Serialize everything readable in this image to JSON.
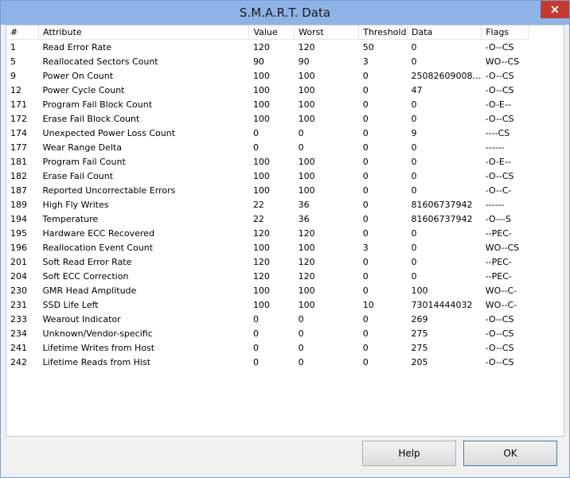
{
  "window": {
    "title": "S.M.A.R.T. Data",
    "close_glyph": "✕"
  },
  "table": {
    "columns": [
      "#",
      "Attribute",
      "Value",
      "Worst",
      "Threshold",
      "Data",
      "Flags"
    ],
    "rows": [
      [
        "1",
        "Read Error Rate",
        "120",
        "120",
        "50",
        "0",
        "-O--CS"
      ],
      [
        "5",
        "Reallocated Sectors Count",
        "90",
        "90",
        "3",
        "0",
        "WO--CS"
      ],
      [
        "9",
        "Power On Count",
        "100",
        "100",
        "0",
        "250826090086...",
        "-O--CS"
      ],
      [
        "12",
        "Power Cycle Count",
        "100",
        "100",
        "0",
        "47",
        "-O--CS"
      ],
      [
        "171",
        "Program Fail Block Count",
        "100",
        "100",
        "0",
        "0",
        "-O-E--"
      ],
      [
        "172",
        "Erase Fail Block Count",
        "100",
        "100",
        "0",
        "0",
        "-O--CS"
      ],
      [
        "174",
        "Unexpected Power Loss Count",
        "0",
        "0",
        "0",
        "9",
        "----CS"
      ],
      [
        "177",
        "Wear Range Delta",
        "0",
        "0",
        "0",
        "0",
        "------"
      ],
      [
        "181",
        "Program Fail Count",
        "100",
        "100",
        "0",
        "0",
        "-O-E--"
      ],
      [
        "182",
        "Erase Fail Count",
        "100",
        "100",
        "0",
        "0",
        "-O--CS"
      ],
      [
        "187",
        "Reported Uncorrectable Errors",
        "100",
        "100",
        "0",
        "0",
        "-O--C-"
      ],
      [
        "189",
        "High Fly Writes",
        "22",
        "36",
        "0",
        "81606737942",
        "------"
      ],
      [
        "194",
        "Temperature",
        "22",
        "36",
        "0",
        "81606737942",
        "-O---S"
      ],
      [
        "195",
        "Hardware ECC Recovered",
        "120",
        "120",
        "0",
        "0",
        "--PEC-"
      ],
      [
        "196",
        "Reallocation Event Count",
        "100",
        "100",
        "3",
        "0",
        "WO--CS"
      ],
      [
        "201",
        "Soft Read Error Rate",
        "120",
        "120",
        "0",
        "0",
        "--PEC-"
      ],
      [
        "204",
        "Soft ECC Correction",
        "120",
        "120",
        "0",
        "0",
        "--PEC-"
      ],
      [
        "230",
        "GMR Head Amplitude",
        "100",
        "100",
        "0",
        "100",
        "WO--C-"
      ],
      [
        "231",
        "SSD Life Left",
        "100",
        "100",
        "10",
        "73014444032",
        "WO--C-"
      ],
      [
        "233",
        "Wearout Indicator",
        "0",
        "0",
        "0",
        "269",
        "-O--CS"
      ],
      [
        "234",
        "Unknown/Vendor-specific",
        "0",
        "0",
        "0",
        "275",
        "-O--CS"
      ],
      [
        "241",
        "Lifetime Writes from Host",
        "0",
        "0",
        "0",
        "275",
        "-O--CS"
      ],
      [
        "242",
        "Lifetime Reads from Hist",
        "0",
        "0",
        "0",
        "205",
        "-O--CS"
      ]
    ]
  },
  "buttons": {
    "help": "Help",
    "ok": "OK"
  }
}
